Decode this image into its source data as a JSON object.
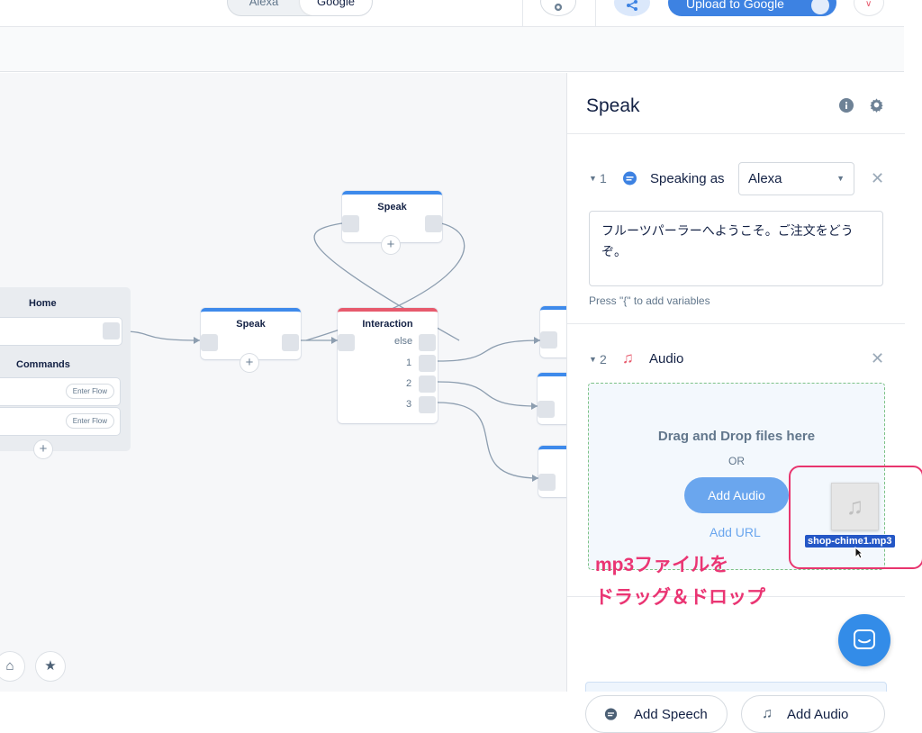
{
  "topbar": {
    "platform_toggle": {
      "options": [
        "Alexa",
        "Google"
      ],
      "active": "Google"
    },
    "upload_label": "Upload to Google"
  },
  "canvas": {
    "home": {
      "title": "Home",
      "commands_label": "Commands",
      "enter_flow": "Enter Flow"
    },
    "speak_top": {
      "title": "Speak"
    },
    "speak_mid": {
      "title": "Speak"
    },
    "interaction": {
      "title": "Interaction",
      "else_label": "else",
      "choices": [
        "1",
        "2",
        "3"
      ]
    }
  },
  "panel": {
    "title": "Speak",
    "step1": {
      "num": "1",
      "label": "Speaking as",
      "voice": "Alexa",
      "text": "フルーツパーラーへようこそ。ご注文をどうぞ。",
      "hint": "Press \"{\" to add variables"
    },
    "step2": {
      "num": "2",
      "label": "Audio"
    },
    "dropzone": {
      "title": "Drag and Drop files here",
      "or": "OR",
      "add_audio": "Add Audio",
      "add_url": "Add URL",
      "file_name": "shop-chime1.mp3"
    },
    "add_speech": "Add Speech",
    "add_audio_bottom": "Add Audio"
  },
  "annotation": {
    "line1": "mp3ファイルを",
    "line2": "ドラッグ＆ドロップ"
  },
  "colors": {
    "primary": "#3d82e2",
    "interaction": "#e75a6d",
    "annotation": "#ea3573"
  }
}
